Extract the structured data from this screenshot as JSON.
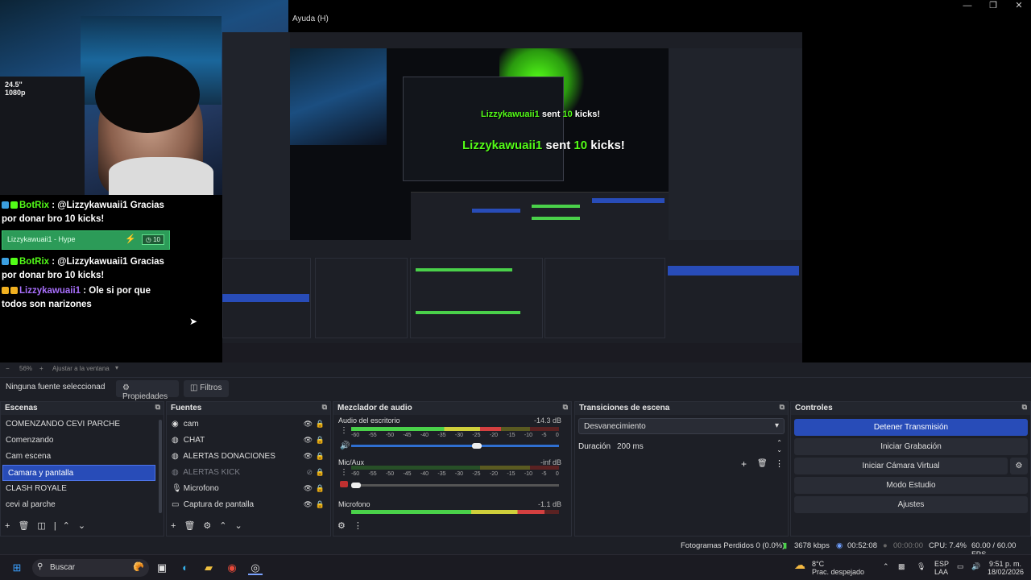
{
  "window": {
    "menu_help": "Ayuda (H)"
  },
  "chat": {
    "messages": [
      {
        "user": "BotRix",
        "text": " : @Lizzykawuaii1 Gracias por donar bro 10 kicks!"
      },
      {
        "user": "BotRix",
        "text": " : @Lizzykawuaii1 Gracias por donar bro 10 kicks!"
      },
      {
        "user": "Lizzykawuaii1",
        "text": " : Ole si por que todos son narizones"
      }
    ],
    "hype": {
      "user": "Lizzykawuaii1",
      "label": " - Hype",
      "count": "10"
    }
  },
  "alert": {
    "user": "Lizzykawuaii1",
    "sent": " sent ",
    "amount": "10",
    "unit": " kicks!"
  },
  "zoom": {
    "percent": "56%",
    "fit": "Ajustar a la ventana"
  },
  "toolbar": {
    "no_source": "Ninguna fuente seleccionad",
    "properties": "Propiedades",
    "filters": "Filtros"
  },
  "scenes": {
    "title": "Escenas",
    "items": [
      "COMENZANDO CEVI PARCHE",
      "Comenzando",
      "Cam escena",
      "Camara y pantalla",
      "CLASH ROYALE",
      "cevi al parche"
    ],
    "selected": 3
  },
  "sources": {
    "title": "Fuentes",
    "items": [
      {
        "name": "cam",
        "icon": "camera-icon"
      },
      {
        "name": "CHAT",
        "icon": "browser-icon"
      },
      {
        "name": "ALERTAS DONACIONES",
        "icon": "browser-icon"
      },
      {
        "name": "ALERTAS KICK",
        "icon": "browser-icon"
      },
      {
        "name": "Microfono",
        "icon": "microphone-icon"
      },
      {
        "name": "Captura de pantalla",
        "icon": "monitor-icon"
      }
    ]
  },
  "mixer": {
    "title": "Mezclador de audio",
    "channels": [
      {
        "name": "Audio del escritorio",
        "db": "-14.3 dB",
        "level": 0.72
      },
      {
        "name": "Mic/Aux",
        "db": "-inf dB",
        "level": 0.0
      },
      {
        "name": "Microfono",
        "db": "-1.1 dB",
        "level": 0.93
      }
    ],
    "scale": [
      "-60",
      "-55",
      "-50",
      "-45",
      "-40",
      "-35",
      "-30",
      "-25",
      "-20",
      "-15",
      "-10",
      "-5",
      "0"
    ]
  },
  "transitions": {
    "title": "Transiciones de escena",
    "selected": "Desvanecimiento",
    "duration_label": "Duración",
    "duration_value": "200 ms"
  },
  "controls": {
    "title": "Controles",
    "stop_stream": "Detener Transmisión",
    "start_recording": "Iniciar Grabación",
    "start_virtual_cam": "Iniciar Cámara Virtual",
    "studio_mode": "Modo Estudio",
    "settings": "Ajustes"
  },
  "status": {
    "dropped": "Fotogramas Perdidos 0 (0.0%)",
    "bitrate": "3678 kbps",
    "stream_time": "00:52:08",
    "rec_time": "00:00:00",
    "cpu": "CPU: 7.4%",
    "fps": "60.00 / 60.00 FPS"
  },
  "taskbar": {
    "search": "Buscar",
    "weather_temp": "8°C",
    "weather_desc": "Prac. despejado",
    "lang1": "ESP",
    "lang2": "LAA",
    "time": "9:51 p. m.",
    "date": "18/02/2026"
  },
  "colors": {
    "accent": "#284cb8",
    "kick_green": "#53fc18"
  }
}
